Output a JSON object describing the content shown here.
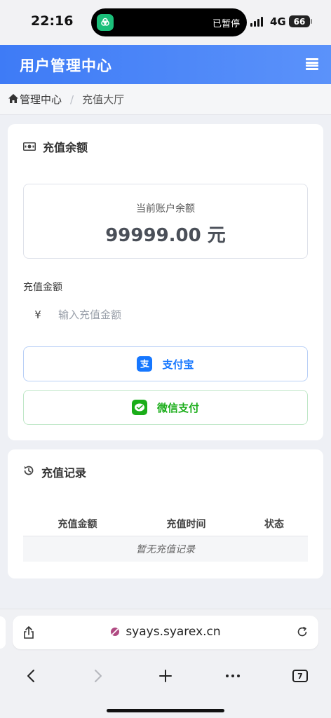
{
  "status_bar": {
    "time": "22:16",
    "island_text": "已暂停",
    "network": "4G",
    "battery": "66"
  },
  "header": {
    "title": "用户管理中心"
  },
  "breadcrumb": {
    "home": "管理中心",
    "separator": "/",
    "current": "充值大厅"
  },
  "recharge_card": {
    "title": "充值余额",
    "balance_label": "当前账户余额",
    "balance_value": "99999.00 元",
    "amount_label": "充值金额",
    "currency_symbol": "¥",
    "amount_placeholder": "输入充值金额",
    "alipay_label": "支付宝",
    "wechat_label": "微信支付"
  },
  "history_card": {
    "title": "充值记录",
    "columns": [
      "充值金额",
      "充值时间",
      "状态"
    ],
    "empty_text": "暂无充值记录"
  },
  "browser": {
    "url": "syays.syarex.cn",
    "tab_count": "7"
  },
  "colors": {
    "header": "#3e7bf6",
    "alipay": "#1677ff",
    "wechat": "#1aad19"
  }
}
